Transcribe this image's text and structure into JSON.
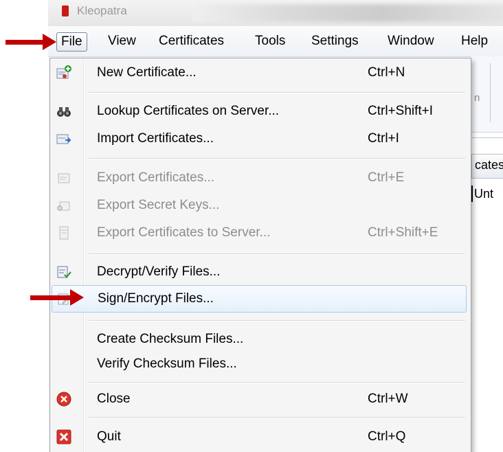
{
  "window": {
    "title": "Kleopatra"
  },
  "menubar": {
    "items": [
      {
        "label": "File",
        "active": true
      },
      {
        "label": "View"
      },
      {
        "label": "Certificates"
      },
      {
        "label": "Tools"
      },
      {
        "label": "Settings"
      },
      {
        "label": "Window"
      },
      {
        "label": "Help"
      }
    ]
  },
  "background": {
    "toolbar_fragment": "n",
    "tab_fragment": "cates",
    "column_fragment": "Unt"
  },
  "file_menu": {
    "items": [
      {
        "label": "New Certificate...",
        "shortcut": "Ctrl+N",
        "icon": "new-certificate-icon",
        "enabled": true
      },
      {
        "label": "Lookup Certificates on Server...",
        "shortcut": "Ctrl+Shift+I",
        "icon": "binoculars-icon",
        "enabled": true
      },
      {
        "label": "Import Certificates...",
        "shortcut": "Ctrl+I",
        "icon": "import-certificates-icon",
        "enabled": true
      },
      {
        "label": "Export Certificates...",
        "shortcut": "Ctrl+E",
        "icon": "export-certificates-icon",
        "enabled": false
      },
      {
        "label": "Export Secret Keys...",
        "shortcut": "",
        "icon": "export-secret-keys-icon",
        "enabled": false
      },
      {
        "label": "Export Certificates to Server...",
        "shortcut": "Ctrl+Shift+E",
        "icon": "export-to-server-icon",
        "enabled": false
      },
      {
        "label": "Decrypt/Verify Files...",
        "shortcut": "",
        "icon": "decrypt-verify-icon",
        "enabled": true
      },
      {
        "label": "Sign/Encrypt Files...",
        "shortcut": "",
        "icon": "sign-encrypt-icon",
        "enabled": true,
        "highlighted": true
      },
      {
        "label": "Create Checksum Files...",
        "shortcut": "",
        "enabled": true
      },
      {
        "label": "Verify Checksum Files...",
        "shortcut": "",
        "enabled": true
      },
      {
        "label": "Close",
        "shortcut": "Ctrl+W",
        "icon": "close-icon",
        "enabled": true
      },
      {
        "label": "Quit",
        "shortcut": "Ctrl+Q",
        "icon": "quit-icon",
        "enabled": true
      }
    ]
  },
  "annotations": {
    "arrow_color": "#c00000",
    "arrow_targets": [
      "File",
      "Sign/Encrypt Files..."
    ]
  }
}
